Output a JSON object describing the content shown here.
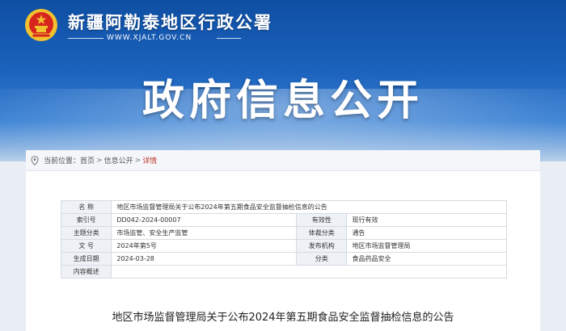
{
  "header": {
    "site_title": "新疆阿勒泰地区行政公署",
    "site_url": "WWW.XJALT.GOV.CN",
    "hero_title": "政府信息公开"
  },
  "breadcrumb": {
    "prefix": "当前位置：",
    "items": [
      "首页",
      "信息公开",
      "详情"
    ],
    "separator": ">"
  },
  "info_table": {
    "title_label": "名 称",
    "title_value": "地区市场监督管理局关于公布2024年第五期食品安全监督抽检信息的公告",
    "rows": [
      {
        "l1": "索引号",
        "v1": "DD042-2024-00007",
        "l2": "有效性",
        "v2": "现行有效"
      },
      {
        "l1": "主题分类",
        "v1": "市场监管、安全生产监管",
        "l2": "体裁分类",
        "v2": "通告"
      },
      {
        "l1": "文 号",
        "v1": "2024年第5号",
        "l2": "发布机构",
        "v2": "地区市场监督管理局"
      },
      {
        "l1": "生成日期",
        "v1": "2024-03-28",
        "l2": "分类",
        "v2": "食品药品安全"
      }
    ],
    "summary_label": "内容概述",
    "summary_value": ""
  },
  "article": {
    "title": "地区市场监督管理局关于公布2024年第五期食品安全监督抽检信息的公告"
  },
  "colors": {
    "banner_blue": "#1b63bd",
    "breadcrumb_current": "#c0392b",
    "emblem_red": "#d7261e",
    "emblem_gold": "#f2c12e"
  }
}
